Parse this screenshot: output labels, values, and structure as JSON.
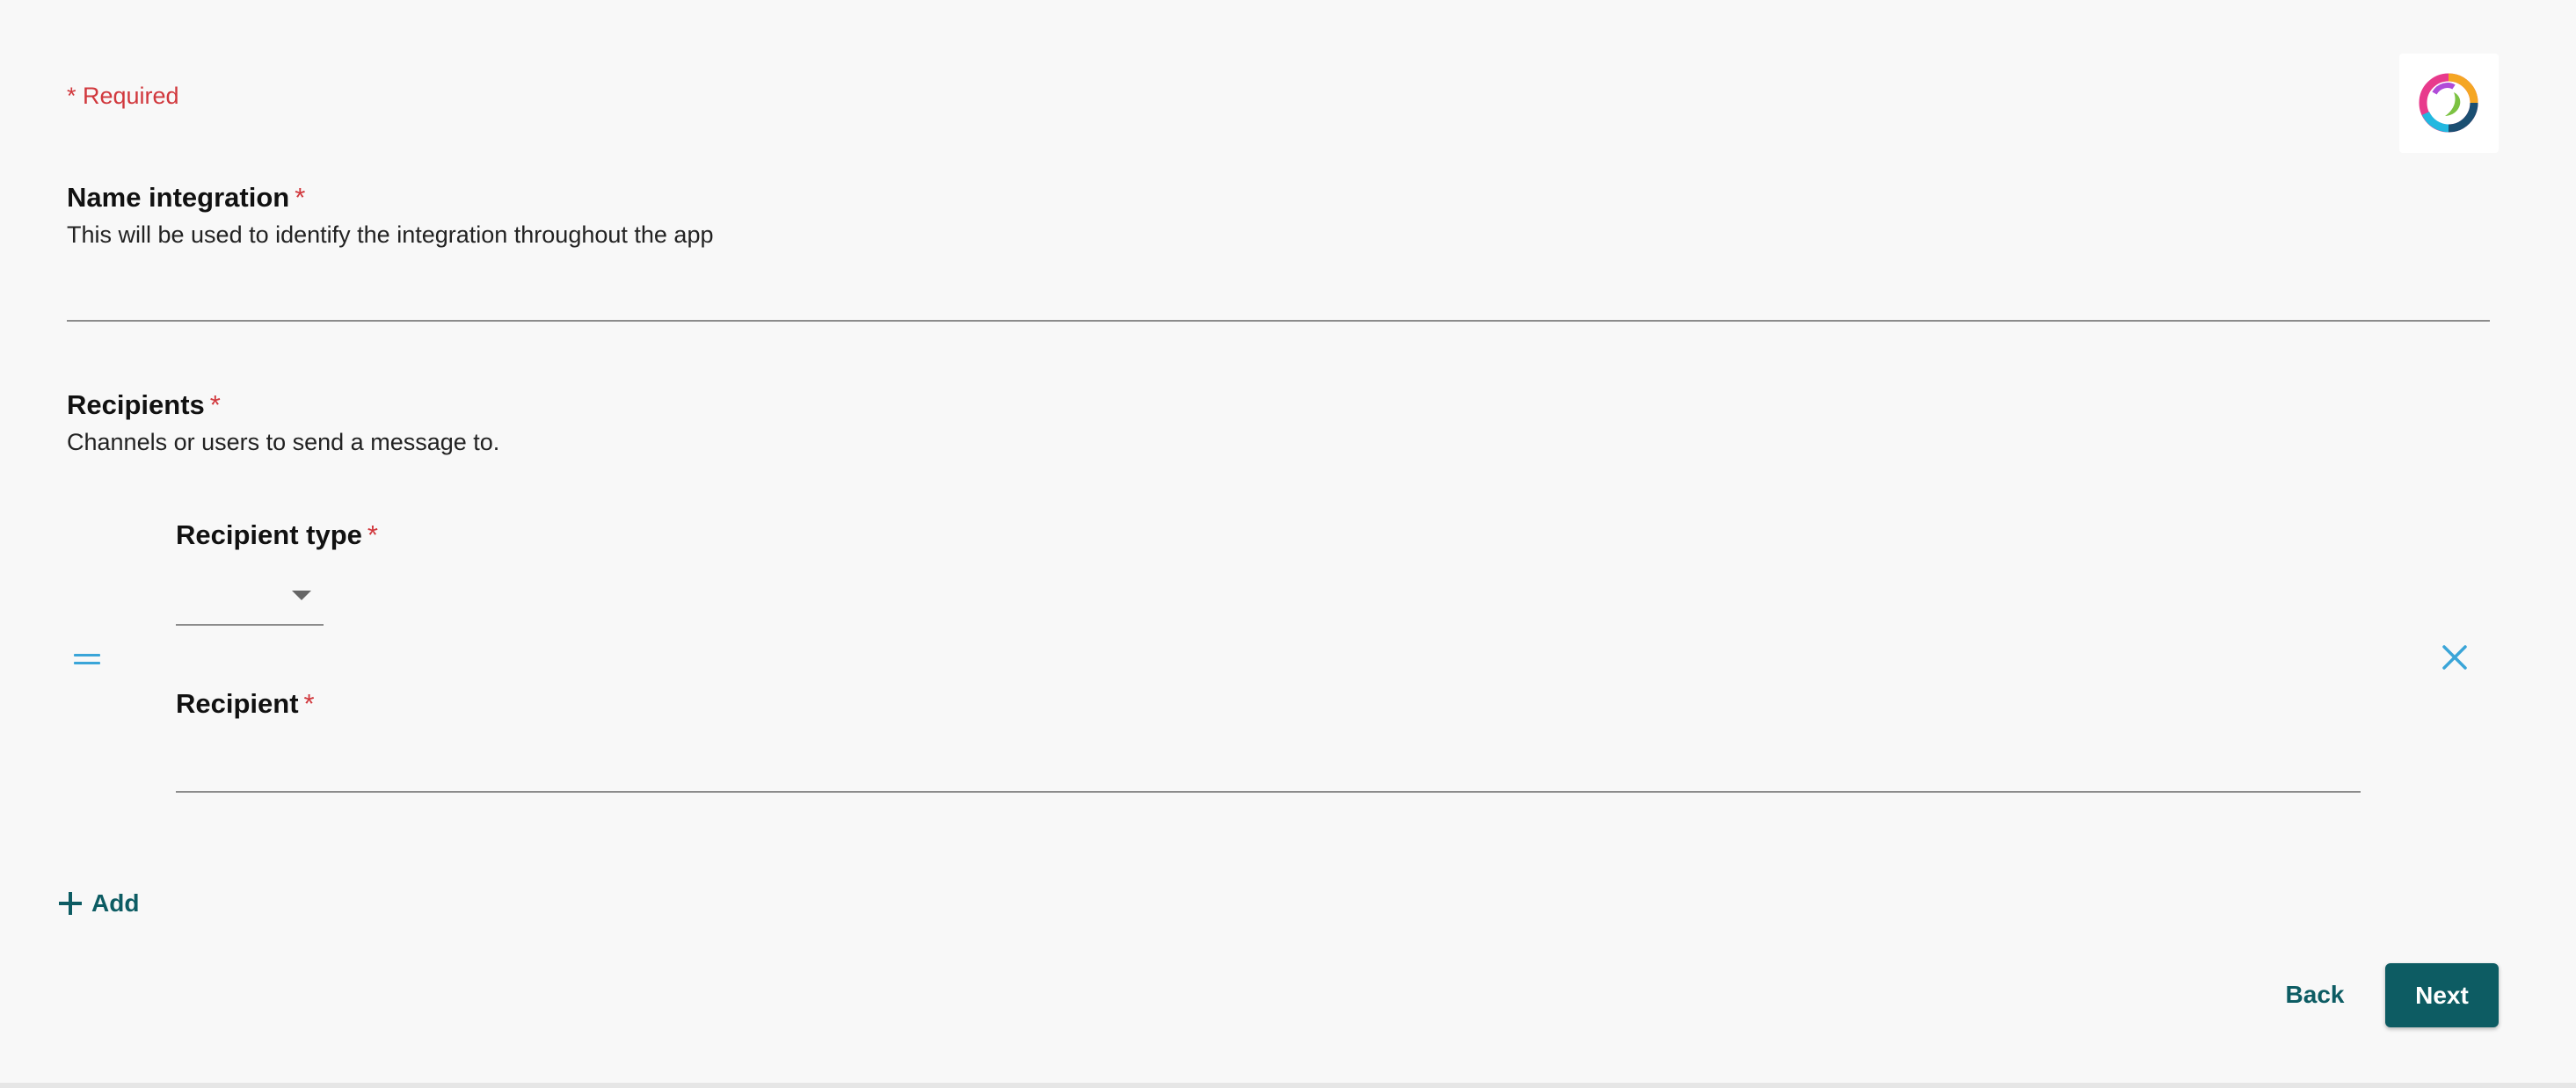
{
  "form": {
    "required_note": "* Required",
    "name_integration": {
      "label": "Name integration",
      "required_mark": "*",
      "help": "This will be used to identify the integration throughout the app",
      "value": "",
      "placeholder": ""
    },
    "recipients": {
      "label": "Recipients",
      "required_mark": "*",
      "help": "Channels or users to send a message to.",
      "items": [
        {
          "recipient_type": {
            "label": "Recipient type",
            "required_mark": "*",
            "selected": ""
          },
          "recipient": {
            "label": "Recipient",
            "required_mark": "*",
            "value": "",
            "placeholder": ""
          }
        }
      ]
    },
    "add_label": "Add"
  },
  "actions": {
    "back_label": "Back",
    "next_label": "Next"
  },
  "icons": {
    "logo": "webex-logo-icon",
    "drag": "drag-handle-icon",
    "close": "close-icon",
    "add": "plus-icon",
    "caret": "caret-down-icon"
  },
  "colors": {
    "accent": "#0d5c63",
    "required": "#d1383d",
    "icon_blue": "#3aa5d8",
    "background": "#f8f8f8"
  }
}
